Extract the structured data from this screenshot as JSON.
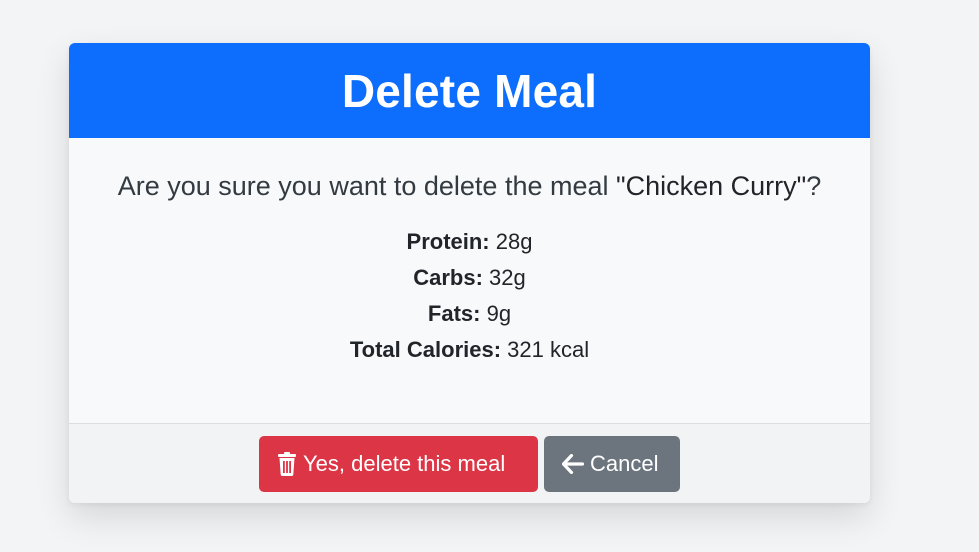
{
  "header": {
    "title": "Delete Meal"
  },
  "body": {
    "question_prefix": "Are you sure you want to delete the meal ",
    "meal_name": "\"Chicken Curry\"",
    "question_suffix": "?",
    "macros": [
      {
        "label": "Protein:",
        "value": "28g"
      },
      {
        "label": "Carbs:",
        "value": "32g"
      },
      {
        "label": "Fats:",
        "value": "9g"
      },
      {
        "label": "Total Calories:",
        "value": "321 kcal"
      }
    ]
  },
  "footer": {
    "delete_label": "Yes, delete this meal",
    "cancel_label": "Cancel",
    "delete_icon": "trash-icon",
    "cancel_icon": "arrow-left-icon"
  },
  "colors": {
    "header_bg": "#0d6efd",
    "danger": "#dc3545",
    "secondary": "#6c757d"
  }
}
